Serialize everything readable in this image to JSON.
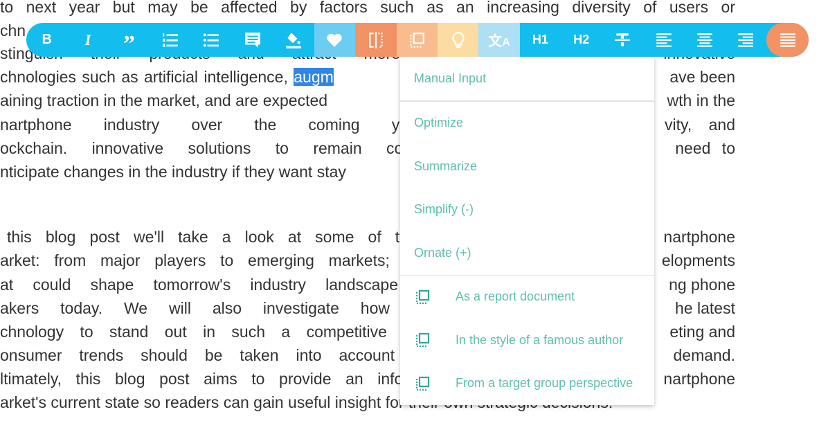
{
  "document": {
    "line1": "to next year but may be affected by factors such as an increasing diversity of users or",
    "line2_left": "chn",
    "line3_left": "stinguish their products and attract more",
    "line3_right": "innovative",
    "line4_left": "chnologies such as artificial intelligence, ",
    "line4_selected": "augm",
    "line4_right": "ave been",
    "line5_left": "aining traction in the market, and are expected",
    "line5_right": "wth in the",
    "line6_left": "nartphone industry over the coming ye",
    "line6_right": "vity, and",
    "line7_left": "ockchain. innovative solutions to remain cor",
    "line7_right": "need to",
    "line8_left": "nticipate changes in the industry if they want stay",
    "line9_left": "this blog post we'll take a look at some of th",
    "line9_right": "nartphone",
    "line10_left": "arket: from major players to emerging markets; t",
    "line10_right": "elopments",
    "line11_left": "at could shape tomorrow's industry landscape",
    "line11_right": "ng phone",
    "line12_left": "akers today. We will also investigate how",
    "line12_right": "he latest",
    "line13_left": "chnology to stand out in such a competitive r",
    "line13_right": "eting and",
    "line14_left": "onsumer trends should be taken into account",
    "line14_right": "demand.",
    "line15_left": "ltimately, this blog post aims to provide an infor",
    "line15_right": "nartphone",
    "line16": "arket's current state so readers can gain useful insight for their own strategic decisions."
  },
  "toolbar": {
    "colors": {
      "primary": "#13bdee",
      "heart": "#6ccdf2",
      "orange": "#f39264",
      "peach": "#f8bc8e",
      "yellow": "#fcdca2",
      "translate": "#addff5"
    },
    "buttons": [
      {
        "name": "bold",
        "icon": "bold-icon",
        "label": "B"
      },
      {
        "name": "italic",
        "icon": "italic-icon",
        "label": "I"
      },
      {
        "name": "quote",
        "icon": "quote-icon"
      },
      {
        "name": "ordered-list",
        "icon": "ordered-list-icon"
      },
      {
        "name": "bullet-list",
        "icon": "bullet-list-icon"
      },
      {
        "name": "comment",
        "icon": "comment-icon"
      },
      {
        "name": "fill-color",
        "icon": "paint-bucket-icon"
      },
      {
        "name": "favorite",
        "icon": "heart-icon"
      },
      {
        "name": "compare",
        "icon": "split-icon"
      },
      {
        "name": "rewrite",
        "icon": "dotted-square-icon"
      },
      {
        "name": "ideas",
        "icon": "lightbulb-icon"
      },
      {
        "name": "translate",
        "icon": "translate-icon"
      },
      {
        "name": "h1",
        "label": "H1"
      },
      {
        "name": "h2",
        "label": "H2"
      },
      {
        "name": "strikethrough",
        "icon": "strikethrough-icon"
      },
      {
        "name": "align-left",
        "icon": "align-left-icon"
      },
      {
        "name": "align-center",
        "icon": "align-center-icon"
      },
      {
        "name": "align-right",
        "icon": "align-right-icon"
      },
      {
        "name": "justify",
        "icon": "justify-icon"
      }
    ]
  },
  "menu": {
    "manual_input": "Manual Input",
    "items": [
      "Optimize",
      "Summarize",
      "Simplify (-)",
      "Ornate (+)"
    ],
    "styled_items": [
      "As a report document",
      "In the style of a famous author",
      "From a target group perspective"
    ]
  }
}
